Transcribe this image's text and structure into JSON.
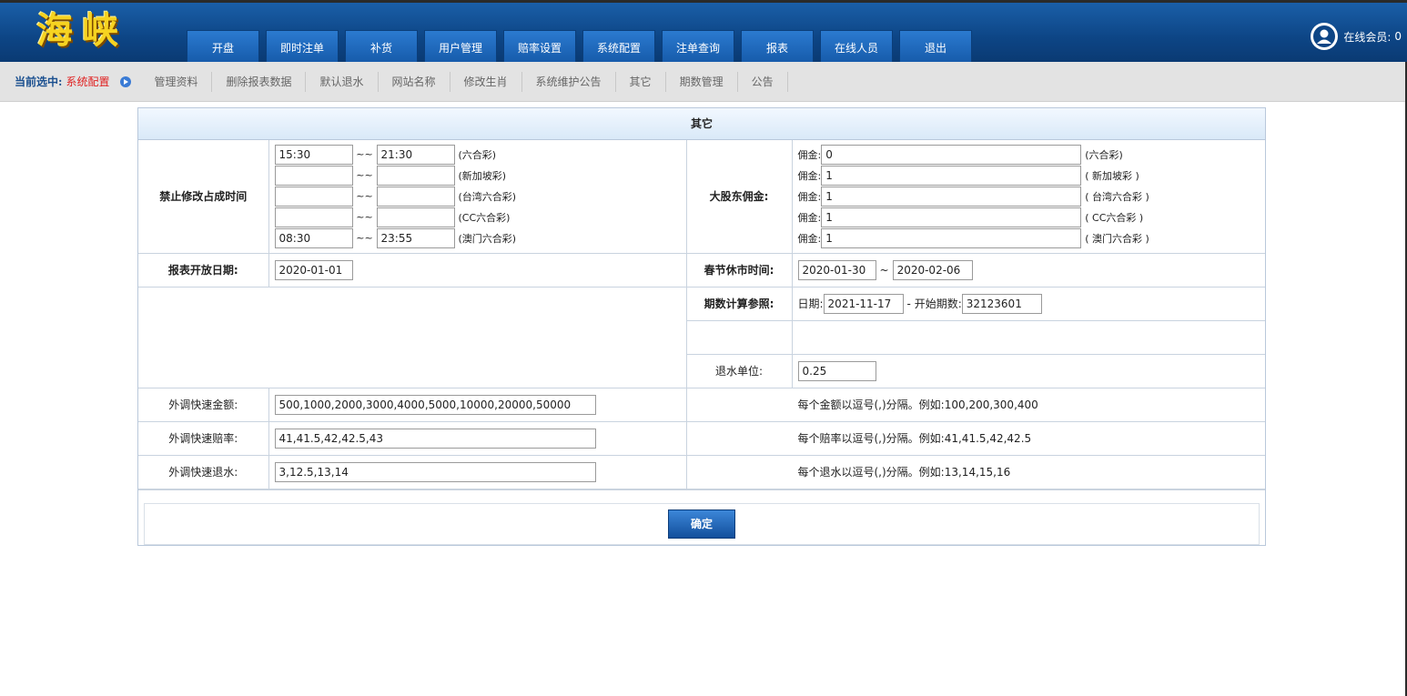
{
  "header": {
    "logo": "海峡",
    "nav": [
      "开盘",
      "即时注单",
      "补货",
      "用户管理",
      "赔率设置",
      "系统配置",
      "注单查询",
      "报表",
      "在线人员",
      "退出"
    ],
    "online_label": "在线会员:",
    "online_count": "0"
  },
  "subnav": {
    "current_label": "当前选中:",
    "current_value": "系统配置",
    "links": [
      "管理资料",
      "删除报表数据",
      "默认退水",
      "网站名称",
      "修改生肖",
      "系统维护公告",
      "其它",
      "期数管理",
      "公告"
    ]
  },
  "panel": {
    "title": "其它",
    "forbid_label": "禁止修改占成时间",
    "time_sep": "~~",
    "time_rows": [
      {
        "start": "15:30",
        "end": "21:30",
        "lottery": "(六合彩)"
      },
      {
        "start": "",
        "end": "",
        "lottery": "(新加坡彩)"
      },
      {
        "start": "",
        "end": "",
        "lottery": "(台湾六合彩)"
      },
      {
        "start": "",
        "end": "",
        "lottery": "(CC六合彩)"
      },
      {
        "start": "08:30",
        "end": "23:55",
        "lottery": "(澳门六合彩)"
      }
    ],
    "commission_label": "大股东佣金:",
    "commission_prefix": "佣金:",
    "commission_rows": [
      {
        "value": "0",
        "lottery": "(六合彩)"
      },
      {
        "value": "1",
        "lottery": "( 新加坡彩 )"
      },
      {
        "value": "1",
        "lottery": "( 台湾六合彩 )"
      },
      {
        "value": "1",
        "lottery": "( CC六合彩 )"
      },
      {
        "value": "1",
        "lottery": "( 澳门六合彩 )"
      }
    ],
    "report_date_label": "报表开放日期:",
    "report_date": "2020-01-01",
    "holiday_label": "春节休市时间:",
    "holiday_start": "2020-01-30",
    "holiday_sep": "~",
    "holiday_end": "2020-02-06",
    "period_label": "期数计算参照:",
    "period_date_prefix": "日期:",
    "period_date": "2021-11-17",
    "period_start_prefix": "- 开始期数:",
    "period_start": "32123601",
    "rebate_unit_label": "退水单位:",
    "rebate_unit": "0.25",
    "quick_rows": [
      {
        "label": "外调快速金额:",
        "value": "500,1000,2000,3000,4000,5000,10000,20000,50000",
        "hint": "每个金额以逗号(,)分隔。例如:100,200,300,400"
      },
      {
        "label": "外调快速赔率:",
        "value": "41,41.5,42,42.5,43",
        "hint": "每个赔率以逗号(,)分隔。例如:41,41.5,42,42.5"
      },
      {
        "label": "外调快速退水:",
        "value": "3,12.5,13,14",
        "hint": "每个退水以逗号(,)分隔。例如:13,14,15,16"
      }
    ],
    "confirm": "确定"
  }
}
